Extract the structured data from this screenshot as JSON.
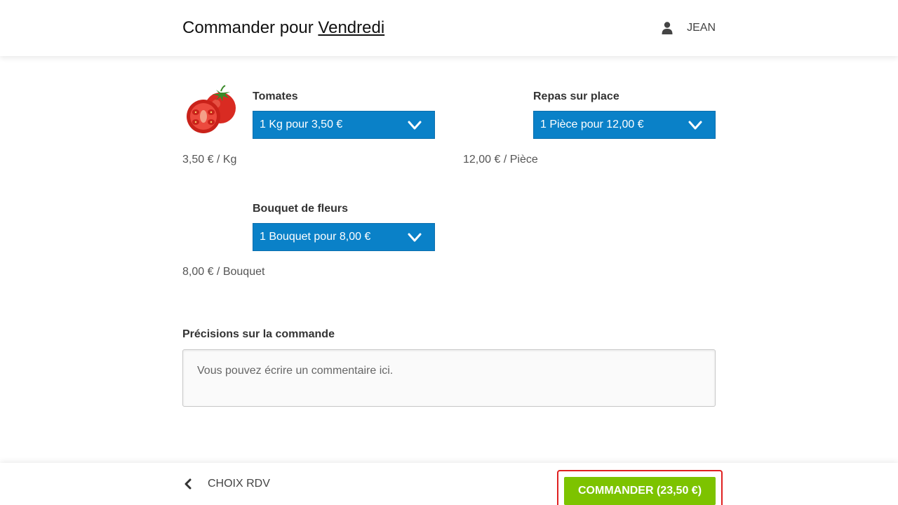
{
  "header": {
    "title_prefix": "Commander pour",
    "day": "Vendredi",
    "user_icon": "user-icon",
    "user_name": "JEAN"
  },
  "products": [
    {
      "name": "Tomates",
      "selected_option": "1 Kg pour 3,50 €",
      "unit_price": "3,50 € / Kg",
      "image": "tomato-image"
    },
    {
      "name": "Repas sur place",
      "selected_option": "1 Pièce pour 12,00 €",
      "unit_price": "12,00 € / Pièce"
    },
    {
      "name": "Bouquet de fleurs",
      "selected_option": "1 Bouquet pour 8,00 €",
      "unit_price": "8,00 € / Bouquet"
    }
  ],
  "notes": {
    "label": "Précisions sur la commande",
    "placeholder": "Vous pouvez écrire un commentaire ici.",
    "value": ""
  },
  "footer": {
    "back_label": "CHOIX RDV",
    "order_label": "COMMANDER (23,50 €)"
  },
  "colors": {
    "select_bg": "#0a81c8",
    "order_bg": "#7dc300",
    "highlight_border": "#e02020"
  }
}
